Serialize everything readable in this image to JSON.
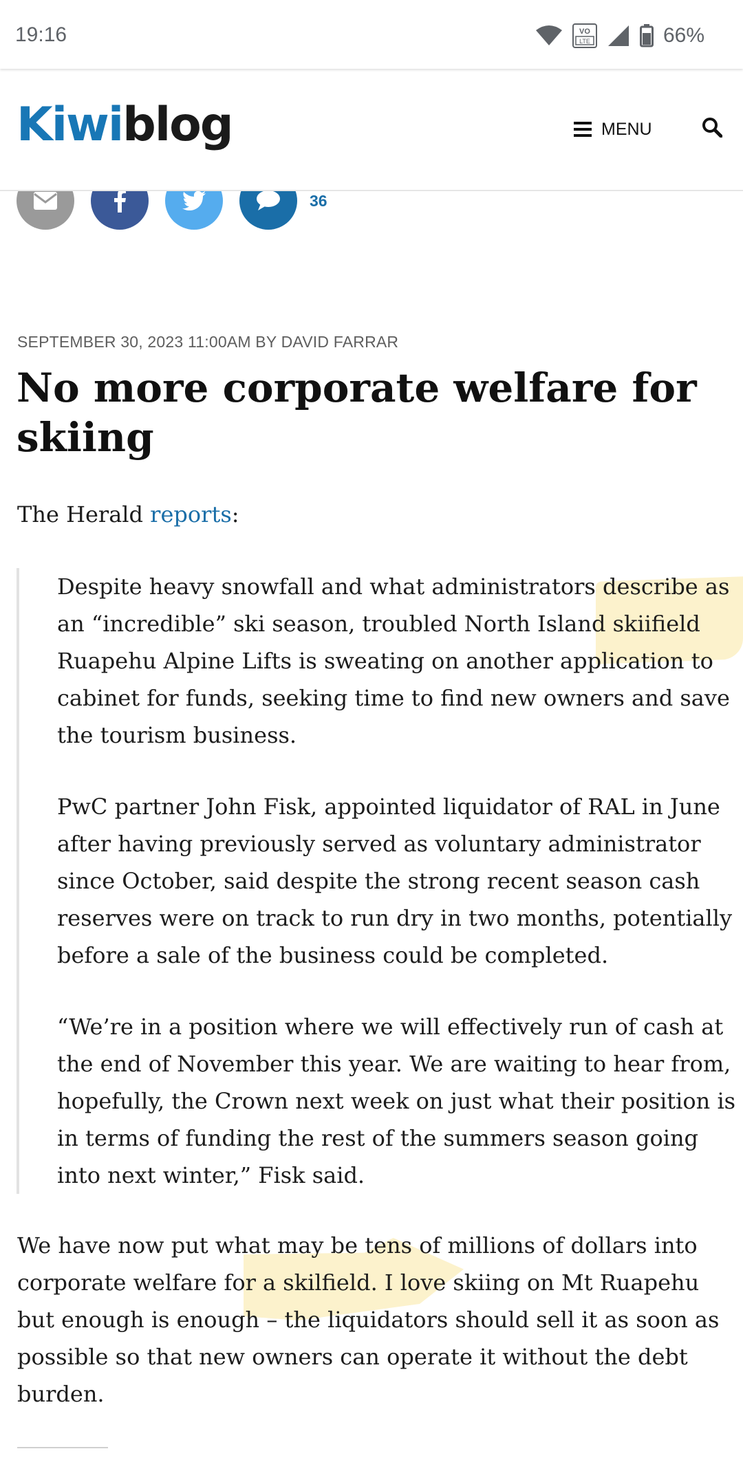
{
  "status_bar": {
    "time": "19:16",
    "battery_text": "66%",
    "volte_label": "VO LTE",
    "icons": [
      "wifi-icon",
      "volte-icon",
      "signal-icon",
      "battery-icon"
    ]
  },
  "header": {
    "logo_part1": "Kiwi",
    "logo_part2": "blog",
    "menu_label": "MENU",
    "brand_color": "#1877b6"
  },
  "share": {
    "buttons": [
      {
        "name": "email",
        "icon": "envelope-icon",
        "color": "#9a9a9a"
      },
      {
        "name": "facebook",
        "icon": "facebook-icon",
        "color": "#3b5998"
      },
      {
        "name": "twitter",
        "icon": "twitter-icon",
        "color": "#55acee"
      },
      {
        "name": "comments",
        "icon": "speech-bubble-icon",
        "color": "#1a6ea8"
      }
    ],
    "comment_count": "36"
  },
  "article": {
    "meta": "SEPTEMBER 30, 2023 11:00AM BY DAVID FARRAR",
    "title": "No more corporate welfare for skiing",
    "intro_prefix": "The Herald ",
    "intro_link": "reports",
    "intro_suffix": ":",
    "quote_paragraphs": [
      "Despite heavy snowfall and what administrators describe as an “incredible” ski season, troubled North Island skiifield Ruapehu Alpine Lifts is sweating on another application to cabinet for funds, seeking time to find new owners and save the tourism business.",
      "PwC partner John Fisk, appointed liquidator of RAL in June after having previously served as voluntary administrator since October, said despite the strong recent season cash reserves were on track to run dry in two months, potentially before a sale of the business could be completed.",
      "“We’re in a position where we will effectively run of cash at the end of November this year. We are waiting to hear from, hopefully, the Crown next week on just what their position is in terms of funding the rest of the summers season going into next winter,” Fisk said."
    ],
    "conclusion": "We have now put what may be tens of millions of dollars into corporate welfare for a skilfield. I love skiing on Mt Ruapehu but enough is enough – the liquidators should sell it as soon as possible so that new owners can operate it without the debt burden."
  }
}
